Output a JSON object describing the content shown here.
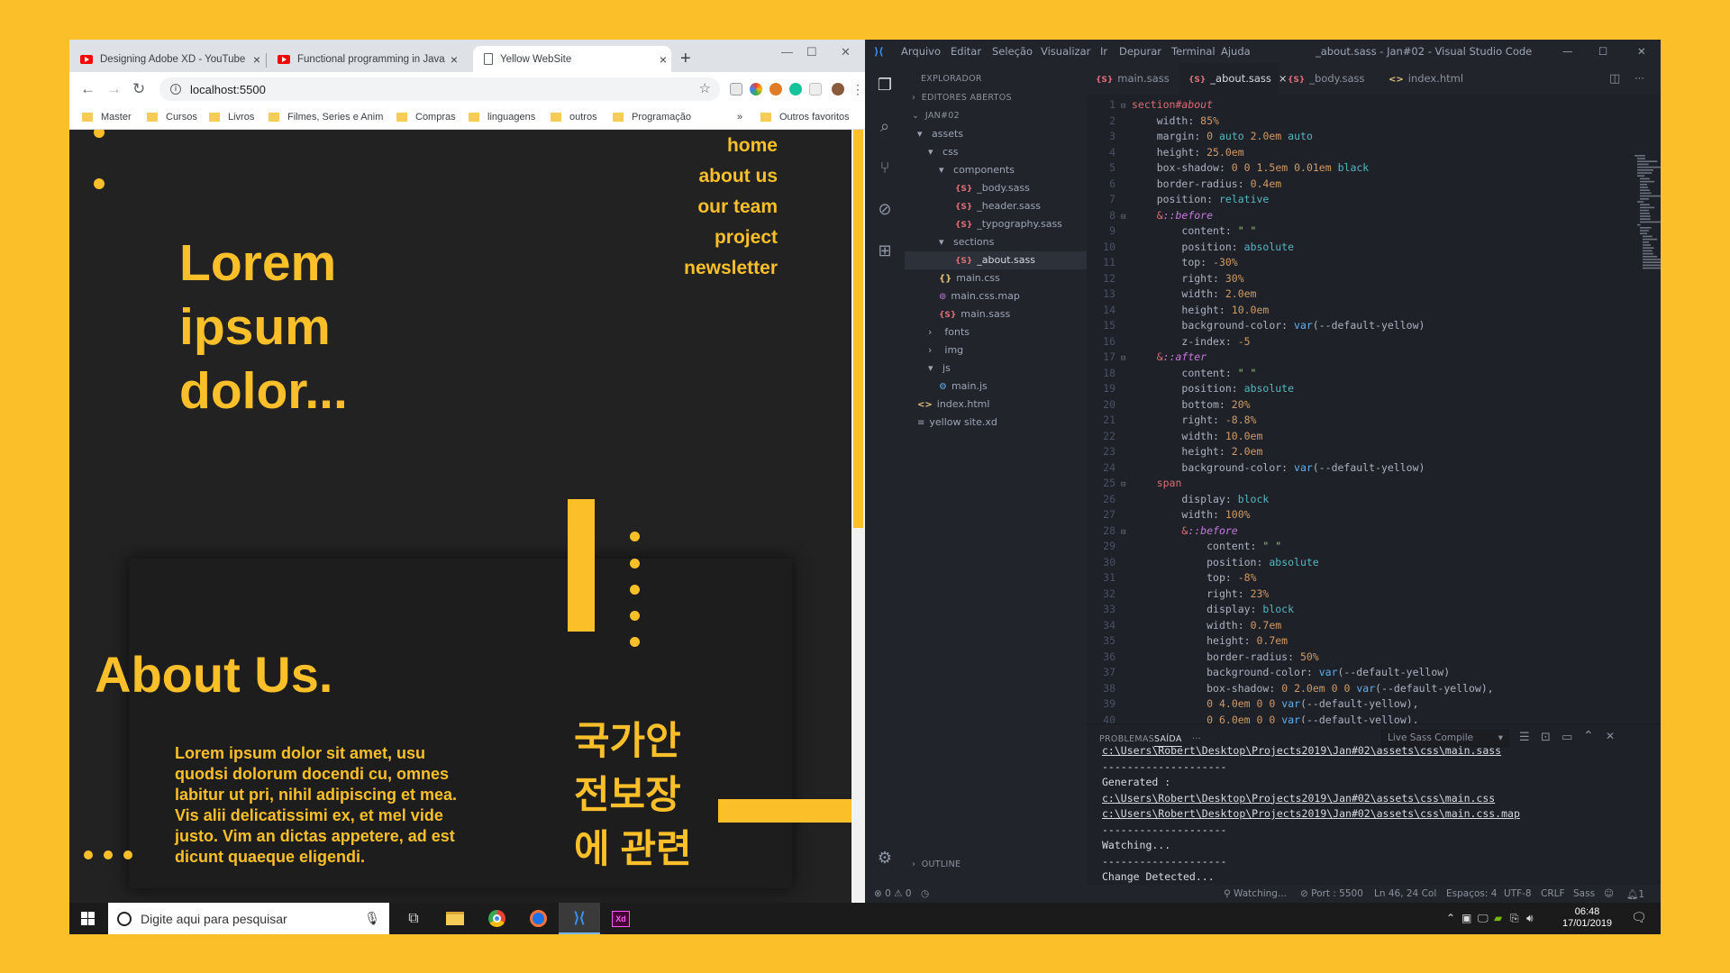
{
  "browser": {
    "tabs": [
      {
        "title": "Designing Adobe XD - YouTube",
        "icon": "youtube-icon"
      },
      {
        "title": "Functional programming in Java",
        "icon": "youtube-icon"
      },
      {
        "title": "Yellow WebSite",
        "icon": "page-icon"
      }
    ],
    "url": "localhost:5500",
    "bookmarks": [
      "Master",
      "Cursos",
      "Livros",
      "Filmes, Series e Anim",
      "Compras",
      "linguagens",
      "outros",
      "Programação"
    ],
    "other_bookmarks": "Outros favoritos"
  },
  "site": {
    "nav": [
      "home",
      "about us",
      "our team",
      "project",
      "newsletter"
    ],
    "hero": [
      "Lorem",
      "ipsum",
      "dolor..."
    ],
    "about_title": "About Us.",
    "about_text": "Lorem ipsum dolor sit amet, usu quodsi dolorum docendi cu, omnes labitur ut pri, nihil adipiscing et mea. Vis alii delicatissimi ex, et mel vide justo. Vim an dictas appetere, ad est dicunt quaeque eligendi.",
    "korean": [
      "국가안",
      "전보장",
      "에 관련"
    ],
    "accent": "#FBBF2A",
    "background": "#222222"
  },
  "vscode": {
    "menu": [
      "Arquivo",
      "Editar",
      "Seleção",
      "Visualizar",
      "Ir",
      "Depurar",
      "Terminal",
      "Ajuda"
    ],
    "title": "_about.sass - Jan#02 - Visual Studio Code",
    "explorer": {
      "header": "EXPLORADOR",
      "open_editors": "EDITORES ABERTOS",
      "root": "JAN#02",
      "tree": [
        {
          "name": "assets",
          "type": "folder-open"
        },
        {
          "name": "css",
          "type": "folder-open"
        },
        {
          "name": "components",
          "type": "folder-open"
        },
        {
          "name": "_body.sass",
          "type": "sass"
        },
        {
          "name": "_header.sass",
          "type": "sass"
        },
        {
          "name": "_typography.sass",
          "type": "sass"
        },
        {
          "name": "sections",
          "type": "folder-open"
        },
        {
          "name": "_about.sass",
          "type": "sass",
          "selected": true
        },
        {
          "name": "main.css",
          "type": "css"
        },
        {
          "name": "main.css.map",
          "type": "map"
        },
        {
          "name": "main.sass",
          "type": "sass"
        },
        {
          "name": "fonts",
          "type": "folder"
        },
        {
          "name": "img",
          "type": "folder"
        },
        {
          "name": "js",
          "type": "folder-open"
        },
        {
          "name": "main.js",
          "type": "js"
        },
        {
          "name": "index.html",
          "type": "html"
        },
        {
          "name": "yellow site.xd",
          "type": "xd"
        }
      ],
      "outline": "OUTLINE"
    },
    "editor_tabs": [
      {
        "label": "main.sass",
        "type": "sass"
      },
      {
        "label": "_about.sass",
        "type": "sass",
        "active": true
      },
      {
        "label": "_body.sass",
        "type": "sass"
      },
      {
        "label": "index.html",
        "type": "html"
      }
    ],
    "code": [
      {
        "n": "1",
        "t": [
          [
            "c-sel",
            "section"
          ],
          [
            "c-id",
            "#about"
          ]
        ],
        "fold": true,
        "ind": 0
      },
      {
        "n": "2",
        "t": [
          [
            "code",
            "width: "
          ],
          [
            "c-num",
            "85%"
          ]
        ],
        "ind": 1
      },
      {
        "n": "3",
        "t": [
          [
            "code",
            "margin: "
          ],
          [
            "c-num",
            "0"
          ],
          [
            "code",
            " "
          ],
          [
            "c-val",
            "auto"
          ],
          [
            "code",
            " "
          ],
          [
            "c-num",
            "2.0em"
          ],
          [
            "code",
            " "
          ],
          [
            "c-val",
            "auto"
          ]
        ],
        "ind": 1
      },
      {
        "n": "4",
        "t": [
          [
            "code",
            "height: "
          ],
          [
            "c-num",
            "25.0em"
          ]
        ],
        "ind": 1
      },
      {
        "n": "5",
        "t": [
          [
            "code",
            "box-shadow: "
          ],
          [
            "c-num",
            "0"
          ],
          [
            "code",
            " "
          ],
          [
            "c-num",
            "0"
          ],
          [
            "code",
            " "
          ],
          [
            "c-num",
            "1.5em"
          ],
          [
            "code",
            " "
          ],
          [
            "c-num",
            "0.01em"
          ],
          [
            "code",
            " "
          ],
          [
            "c-val",
            "black"
          ]
        ],
        "ind": 1
      },
      {
        "n": "6",
        "t": [
          [
            "code",
            "border-radius: "
          ],
          [
            "c-num",
            "0.4em"
          ]
        ],
        "ind": 1
      },
      {
        "n": "7",
        "t": [
          [
            "code",
            "position: "
          ],
          [
            "c-val",
            "relative"
          ]
        ],
        "ind": 1
      },
      {
        "n": "8",
        "t": [
          [
            "c-sel",
            "&"
          ],
          [
            "c-kw",
            "::before"
          ]
        ],
        "fold": true,
        "ind": 1
      },
      {
        "n": "9",
        "t": [
          [
            "code",
            "content: "
          ],
          [
            "c-str",
            "\" \""
          ]
        ],
        "ind": 2
      },
      {
        "n": "10",
        "t": [
          [
            "code",
            "position: "
          ],
          [
            "c-val",
            "absolute"
          ]
        ],
        "ind": 2
      },
      {
        "n": "11",
        "t": [
          [
            "code",
            "top: "
          ],
          [
            "c-num",
            "-30%"
          ]
        ],
        "ind": 2
      },
      {
        "n": "12",
        "t": [
          [
            "code",
            "right: "
          ],
          [
            "c-num",
            "30%"
          ]
        ],
        "ind": 2
      },
      {
        "n": "13",
        "t": [
          [
            "code",
            "width: "
          ],
          [
            "c-num",
            "2.0em"
          ]
        ],
        "ind": 2
      },
      {
        "n": "14",
        "t": [
          [
            "code",
            "height: "
          ],
          [
            "c-num",
            "10.0em"
          ]
        ],
        "ind": 2
      },
      {
        "n": "15",
        "t": [
          [
            "code",
            "background-color: "
          ],
          [
            "c-fn",
            "var"
          ],
          [
            "code",
            "(--default-yellow)"
          ]
        ],
        "ind": 2
      },
      {
        "n": "16",
        "t": [
          [
            "code",
            "z-index: "
          ],
          [
            "c-num",
            "-5"
          ]
        ],
        "ind": 2
      },
      {
        "n": "17",
        "t": [
          [
            "c-sel",
            "&"
          ],
          [
            "c-kw",
            "::after"
          ]
        ],
        "fold": true,
        "ind": 1
      },
      {
        "n": "18",
        "t": [
          [
            "code",
            "content: "
          ],
          [
            "c-str",
            "\" \""
          ]
        ],
        "ind": 2
      },
      {
        "n": "19",
        "t": [
          [
            "code",
            "position: "
          ],
          [
            "c-val",
            "absolute"
          ]
        ],
        "ind": 2
      },
      {
        "n": "20",
        "t": [
          [
            "code",
            "bottom: "
          ],
          [
            "c-num",
            "20%"
          ]
        ],
        "ind": 2
      },
      {
        "n": "21",
        "t": [
          [
            "code",
            "right: "
          ],
          [
            "c-num",
            "-8.8%"
          ]
        ],
        "ind": 2
      },
      {
        "n": "22",
        "t": [
          [
            "code",
            "width: "
          ],
          [
            "c-num",
            "10.0em"
          ]
        ],
        "ind": 2
      },
      {
        "n": "23",
        "t": [
          [
            "code",
            "height: "
          ],
          [
            "c-num",
            "2.0em"
          ]
        ],
        "ind": 2
      },
      {
        "n": "24",
        "t": [
          [
            "code",
            "background-color: "
          ],
          [
            "c-fn",
            "var"
          ],
          [
            "code",
            "(--default-yellow)"
          ]
        ],
        "ind": 2
      },
      {
        "n": "25",
        "t": [
          [
            "c-sel",
            "span"
          ]
        ],
        "fold": true,
        "ind": 1
      },
      {
        "n": "26",
        "t": [
          [
            "code",
            "display: "
          ],
          [
            "c-val",
            "block"
          ]
        ],
        "ind": 2
      },
      {
        "n": "27",
        "t": [
          [
            "code",
            "width: "
          ],
          [
            "c-num",
            "100%"
          ]
        ],
        "ind": 2
      },
      {
        "n": "28",
        "t": [
          [
            "c-sel",
            "&"
          ],
          [
            "c-kw",
            "::before"
          ]
        ],
        "fold": true,
        "ind": 2
      },
      {
        "n": "29",
        "t": [
          [
            "code",
            "content: "
          ],
          [
            "c-str",
            "\" \""
          ]
        ],
        "ind": 3
      },
      {
        "n": "30",
        "t": [
          [
            "code",
            "position: "
          ],
          [
            "c-val",
            "absolute"
          ]
        ],
        "ind": 3
      },
      {
        "n": "31",
        "t": [
          [
            "code",
            "top: "
          ],
          [
            "c-num",
            "-8%"
          ]
        ],
        "ind": 3
      },
      {
        "n": "32",
        "t": [
          [
            "code",
            "right: "
          ],
          [
            "c-num",
            "23%"
          ]
        ],
        "ind": 3
      },
      {
        "n": "33",
        "t": [
          [
            "code",
            "display: "
          ],
          [
            "c-val",
            "block"
          ]
        ],
        "ind": 3
      },
      {
        "n": "34",
        "t": [
          [
            "code",
            "width: "
          ],
          [
            "c-num",
            "0.7em"
          ]
        ],
        "ind": 3
      },
      {
        "n": "35",
        "t": [
          [
            "code",
            "height: "
          ],
          [
            "c-num",
            "0.7em"
          ]
        ],
        "ind": 3
      },
      {
        "n": "36",
        "t": [
          [
            "code",
            "border-radius: "
          ],
          [
            "c-num",
            "50%"
          ]
        ],
        "ind": 3
      },
      {
        "n": "37",
        "t": [
          [
            "code",
            "background-color: "
          ],
          [
            "c-fn",
            "var"
          ],
          [
            "code",
            "(--default-yellow)"
          ]
        ],
        "ind": 3
      },
      {
        "n": "38",
        "t": [
          [
            "code",
            "box-shadow: "
          ],
          [
            "c-num",
            "0"
          ],
          [
            "code",
            " "
          ],
          [
            "c-num",
            "2.0em"
          ],
          [
            "code",
            " "
          ],
          [
            "c-num",
            "0"
          ],
          [
            "code",
            " "
          ],
          [
            "c-num",
            "0"
          ],
          [
            "code",
            " "
          ],
          [
            "c-fn",
            "var"
          ],
          [
            "code",
            "(--default-yellow),"
          ]
        ],
        "ind": 3
      },
      {
        "n": "39",
        "t": [
          [
            "c-num",
            "0"
          ],
          [
            "code",
            " "
          ],
          [
            "c-num",
            "4.0em"
          ],
          [
            "code",
            " "
          ],
          [
            "c-num",
            "0"
          ],
          [
            "code",
            " "
          ],
          [
            "c-num",
            "0"
          ],
          [
            "code",
            " "
          ],
          [
            "c-fn",
            "var"
          ],
          [
            "code",
            "(--default-yellow),"
          ]
        ],
        "ind": 3
      },
      {
        "n": "40",
        "t": [
          [
            "c-num",
            "0"
          ],
          [
            "code",
            " "
          ],
          [
            "c-num",
            "6.0em"
          ],
          [
            "code",
            " "
          ],
          [
            "c-num",
            "0"
          ],
          [
            "code",
            " "
          ],
          [
            "c-num",
            "0"
          ],
          [
            "code",
            " "
          ],
          [
            "c-fn",
            "var"
          ],
          [
            "code",
            "(--default-yellow),"
          ]
        ],
        "ind": 3
      }
    ],
    "panel": {
      "tabs": [
        "PROBLEMAS",
        "SAÍDA"
      ],
      "more": "···",
      "select": "Live Sass Compile",
      "lines": [
        {
          "text": "c:\\Users\\Robert\\Desktop\\Projects2019\\Jan#02\\assets\\css\\main.sass",
          "link": true
        },
        {
          "text": "--------------------",
          "link": false
        },
        {
          "text": "Generated :",
          "link": false
        },
        {
          "text": "c:\\Users\\Robert\\Desktop\\Projects2019\\Jan#02\\assets\\css\\main.css",
          "link": true
        },
        {
          "text": "c:\\Users\\Robert\\Desktop\\Projects2019\\Jan#02\\assets\\css\\main.css.map",
          "link": true
        },
        {
          "text": "--------------------",
          "link": false
        },
        {
          "text": "Watching...",
          "link": false
        },
        {
          "text": "--------------------",
          "link": false
        },
        {
          "text": "Change Detected...",
          "link": false
        }
      ]
    },
    "status": {
      "problems": "⊗ 0 ⚠ 0",
      "watching": "Watching...",
      "port": "Port : 5500",
      "position": "Ln 46, 24 Col",
      "spaces": "Espaços: 4",
      "encoding": "UTF-8",
      "eol": "CRLF",
      "language": "Sass",
      "notifications": "1"
    }
  },
  "taskbar": {
    "search_placeholder": "Digite aqui para pesquisar",
    "apps": [
      "file-explorer-icon",
      "chrome-icon",
      "firefox-icon",
      "vscode-icon",
      "adobe-xd-icon"
    ],
    "time": "06:48",
    "date": "17/01/2019"
  }
}
